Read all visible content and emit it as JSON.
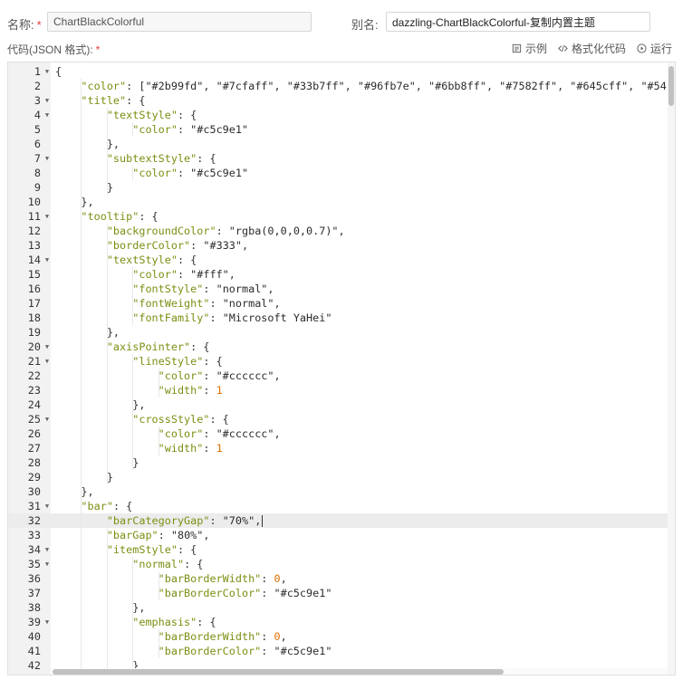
{
  "form": {
    "name_label": "名称:",
    "name_value": "ChartBlackColorful",
    "alias_label": "别名:",
    "alias_value": "dazzling-ChartBlackColorful-复制内置主题",
    "code_label": "代码(JSON 格式):",
    "required_mark": "*"
  },
  "toolbar": {
    "example_label": "示例",
    "format_label": "格式化代码",
    "run_label": "运行"
  },
  "icons": {
    "example": "document-icon",
    "format": "code-icon",
    "run": "play-icon"
  },
  "colors": {
    "required": "#e23c39",
    "key": "#7a8f12",
    "number": "#e07000",
    "active_line": "#ececec"
  },
  "editor": {
    "active_line": 32,
    "lines": [
      {
        "n": "1",
        "fold": true,
        "text": "{"
      },
      {
        "n": "2",
        "fold": false,
        "text": "    \"color\": [\"#2b99fd\", \"#7cfaff\", \"#33b7ff\", \"#96fb7e\", \"#6bb8ff\", \"#7582ff\", \"#645cff\", \"#54"
      },
      {
        "n": "3",
        "fold": true,
        "text": "    \"title\": {"
      },
      {
        "n": "4",
        "fold": true,
        "text": "        \"textStyle\": {"
      },
      {
        "n": "5",
        "fold": false,
        "text": "            \"color\": \"#c5c9e1\""
      },
      {
        "n": "6",
        "fold": false,
        "text": "        },"
      },
      {
        "n": "7",
        "fold": true,
        "text": "        \"subtextStyle\": {"
      },
      {
        "n": "8",
        "fold": false,
        "text": "            \"color\": \"#c5c9e1\""
      },
      {
        "n": "9",
        "fold": false,
        "text": "        }"
      },
      {
        "n": "10",
        "fold": false,
        "text": "    },"
      },
      {
        "n": "11",
        "fold": true,
        "text": "    \"tooltip\": {"
      },
      {
        "n": "12",
        "fold": false,
        "text": "        \"backgroundColor\": \"rgba(0,0,0,0.7)\","
      },
      {
        "n": "13",
        "fold": false,
        "text": "        \"borderColor\": \"#333\","
      },
      {
        "n": "14",
        "fold": true,
        "text": "        \"textStyle\": {"
      },
      {
        "n": "15",
        "fold": false,
        "text": "            \"color\": \"#fff\","
      },
      {
        "n": "16",
        "fold": false,
        "text": "            \"fontStyle\": \"normal\","
      },
      {
        "n": "17",
        "fold": false,
        "text": "            \"fontWeight\": \"normal\","
      },
      {
        "n": "18",
        "fold": false,
        "text": "            \"fontFamily\": \"Microsoft YaHei\""
      },
      {
        "n": "19",
        "fold": false,
        "text": "        },"
      },
      {
        "n": "20",
        "fold": true,
        "text": "        \"axisPointer\": {"
      },
      {
        "n": "21",
        "fold": true,
        "text": "            \"lineStyle\": {"
      },
      {
        "n": "22",
        "fold": false,
        "text": "                \"color\": \"#cccccc\","
      },
      {
        "n": "23",
        "fold": false,
        "text": "                \"width\": 1"
      },
      {
        "n": "24",
        "fold": false,
        "text": "            },"
      },
      {
        "n": "25",
        "fold": true,
        "text": "            \"crossStyle\": {"
      },
      {
        "n": "26",
        "fold": false,
        "text": "                \"color\": \"#cccccc\","
      },
      {
        "n": "27",
        "fold": false,
        "text": "                \"width\": 1"
      },
      {
        "n": "28",
        "fold": false,
        "text": "            }"
      },
      {
        "n": "29",
        "fold": false,
        "text": "        }"
      },
      {
        "n": "30",
        "fold": false,
        "text": "    },"
      },
      {
        "n": "31",
        "fold": true,
        "text": "    \"bar\": {"
      },
      {
        "n": "32",
        "fold": false,
        "text": "        \"barCategoryGap\": \"70%\","
      },
      {
        "n": "33",
        "fold": false,
        "text": "        \"barGap\": \"80%\","
      },
      {
        "n": "34",
        "fold": true,
        "text": "        \"itemStyle\": {"
      },
      {
        "n": "35",
        "fold": true,
        "text": "            \"normal\": {"
      },
      {
        "n": "36",
        "fold": false,
        "text": "                \"barBorderWidth\": 0,"
      },
      {
        "n": "37",
        "fold": false,
        "text": "                \"barBorderColor\": \"#c5c9e1\""
      },
      {
        "n": "38",
        "fold": false,
        "text": "            },"
      },
      {
        "n": "39",
        "fold": true,
        "text": "            \"emphasis\": {"
      },
      {
        "n": "40",
        "fold": false,
        "text": "                \"barBorderWidth\": 0,"
      },
      {
        "n": "41",
        "fold": false,
        "text": "                \"barBorderColor\": \"#c5c9e1\""
      },
      {
        "n": "42",
        "fold": false,
        "text": "            }"
      }
    ]
  }
}
